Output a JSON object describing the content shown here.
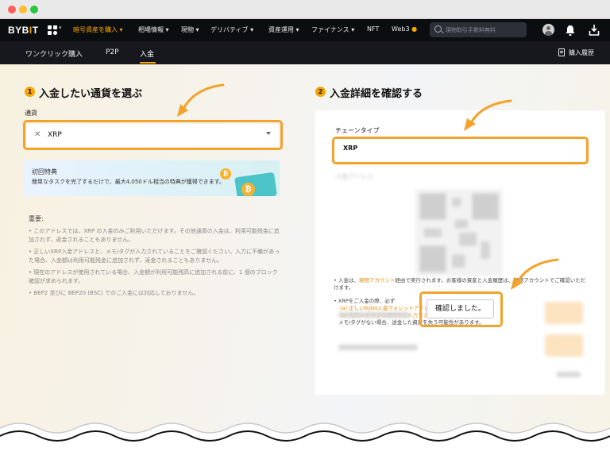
{
  "window": {
    "controls": [
      "close",
      "minimize",
      "zoom"
    ]
  },
  "nav": {
    "logo_main": "BYB",
    "logo_accent": "I",
    "logo_end": "T",
    "items": [
      "暗号資産を購入",
      "相場情報",
      "現物",
      "デリバティブ",
      "資産運用",
      "ファイナンス",
      "NFT",
      "Web3"
    ],
    "active_item": "暗号資産を購入",
    "search_placeholder": "現物取引手数料無料",
    "accent_color": "#f7a600"
  },
  "subnav": {
    "items": [
      "ワンクリック購入",
      "P2P",
      "入金"
    ],
    "active_item": "入金",
    "history_label": "購入履歴"
  },
  "left": {
    "step_number": "1",
    "title": "入金したい通貨を選ぶ",
    "currency_label": "通貨",
    "currency_value": "XRP",
    "promo_title": "初回特典",
    "promo_desc": "簡単なタスクを完了するだけで、最大4,050ドル相当の特典が獲得できます。",
    "notes_heading": "重要:",
    "notes": [
      "• このアドレスでは、XRP の入金のみご利用いただけます。その他通貨の入金は、利用可能残金に追加されず、返金されることもありません。",
      "• 正しいXRP入金アドレスと、メモ/タグが入力されていることをご確認ください。入力に不備があった場合、入金額は利用可能残金に追加されず、返金されることもありません。",
      "• 現在のアドレスが使用されている場合、入金額が利用可能残高に追加される前に、1 個のブロック確認が求められます。",
      "• BEP2 並びに BEP20 (BSC) でのご入金には対応しておりません。"
    ]
  },
  "right": {
    "step_number": "2",
    "title": "入金詳細を確認する",
    "chain_label": "チェーンタイプ",
    "chain_value": "XRP",
    "deposit_address_label": "入金アドレス",
    "info_line1_prefix": "• 入金は、",
    "info_line1_link": "現物アカウント",
    "info_line1_suffix": "経由で実行されます。お客様の資産と入金履歴は、現物アカウントでご確認いただけます。",
    "info_line2": "• XRPをご入金の際、必ず",
    "info_line3": "(a) 正しいBybit入金ウォレットアドレスと",
    "info_line4": "(b) 宛先メモ/タグの両方をご入力下さい。",
    "info_line5": "メモ/タグがない場合、送金した資産を失う可能性があります。",
    "confirm_button": "確認しました。"
  },
  "highlight_color": "#f3a22b"
}
